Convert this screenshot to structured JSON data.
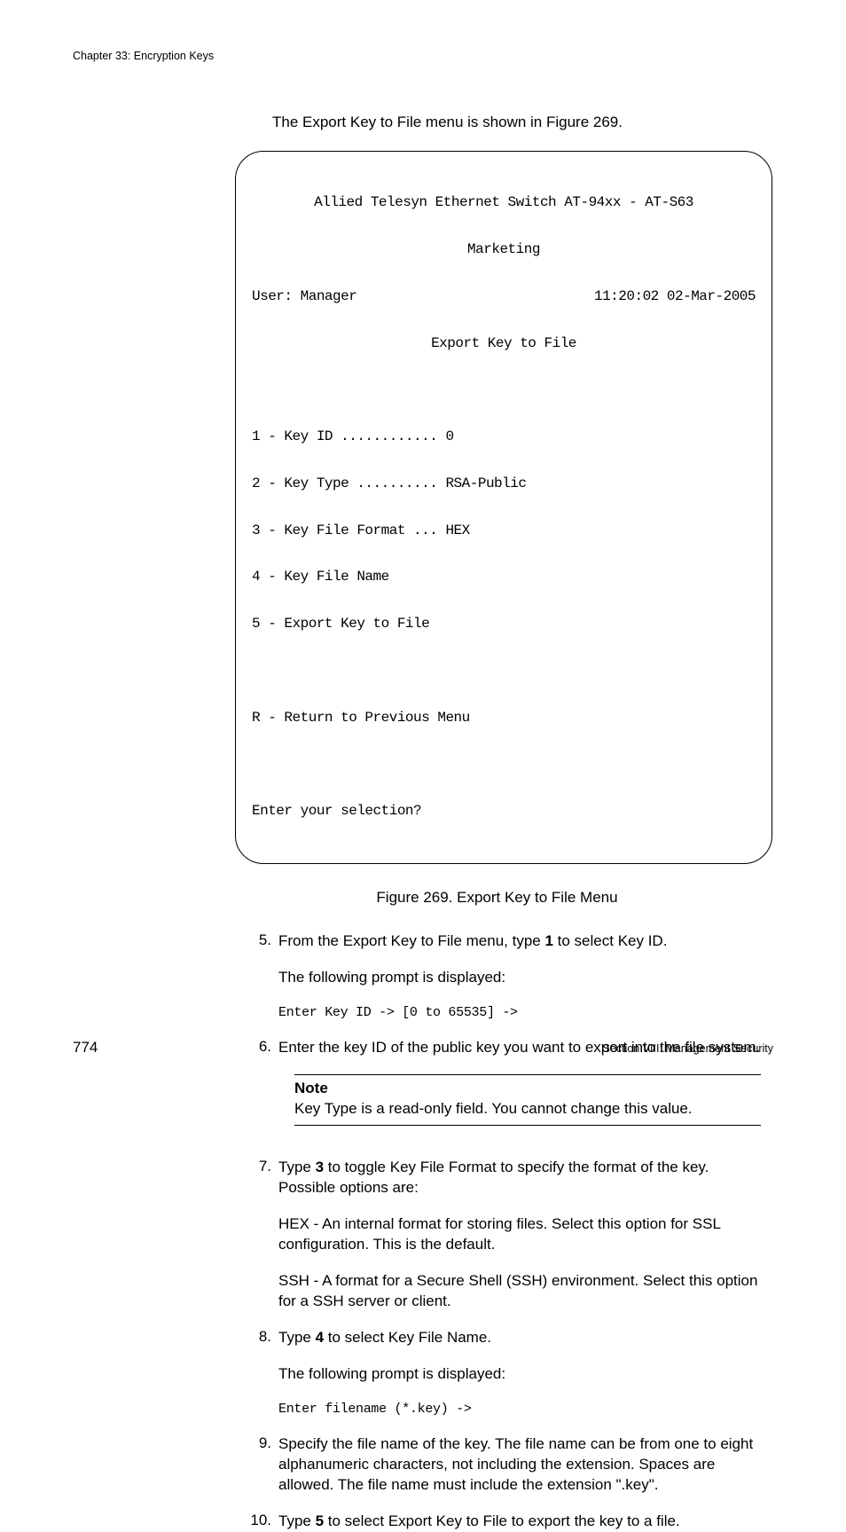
{
  "header": {
    "chapter": "Chapter 33: Encryption Keys"
  },
  "intro": "The Export Key to File menu is shown in Figure 269.",
  "terminal": {
    "banner1": "Allied Telesyn Ethernet Switch AT-94xx - AT-S63",
    "banner2": "Marketing",
    "user_left": "User: Manager",
    "user_right": "11:20:02 02-Mar-2005",
    "title": "Export Key to File",
    "l1": "1 - Key ID ............ 0",
    "l2": "2 - Key Type .......... RSA-Public",
    "l3": "3 - Key File Format ... HEX",
    "l4": "4 - Key File Name",
    "l5": "5 - Export Key to File",
    "lr": "R - Return to Previous Menu",
    "prompt": "Enter your selection?"
  },
  "caption": "Figure 269. Export Key to File Menu",
  "steps": {
    "s5": {
      "num": "5.",
      "a1": "From the Export Key to File menu, type ",
      "a2": "1",
      "a3": " to select Key ID.",
      "b": "The following prompt is displayed:",
      "c": "Enter Key ID -> [0 to 65535] ->"
    },
    "s6": {
      "num": "6.",
      "a": "Enter the key ID of the public key you want to export into the file system."
    },
    "note": {
      "title": "Note",
      "body": "Key Type is a read-only field. You cannot change this value."
    },
    "s7": {
      "num": "7.",
      "a1": "Type ",
      "a2": "3",
      "a3": " to toggle Key File Format to specify the format of the key. Possible options are:",
      "b": "HEX - An internal format for storing files. Select this option for SSL configuration. This is the default.",
      "c": "SSH - A format for a Secure Shell (SSH) environment. Select this option for a SSH server or client."
    },
    "s8": {
      "num": "8.",
      "a1": "Type ",
      "a2": "4",
      "a3": " to select Key File Name.",
      "b": "The following prompt is displayed:",
      "c": "Enter filename (*.key) ->"
    },
    "s9": {
      "num": "9.",
      "a": "Specify the file name of the key. The file name can be from one to eight alphanumeric characters, not including the extension. Spaces are allowed. The file name must include the extension \".key\"."
    },
    "s10": {
      "num": "10.",
      "a1": "Type ",
      "a2": "5",
      "a3": " to select Export Key to File to export the key to a file."
    }
  },
  "footer": {
    "page": "774",
    "section": "Section VIII: Management Security"
  }
}
